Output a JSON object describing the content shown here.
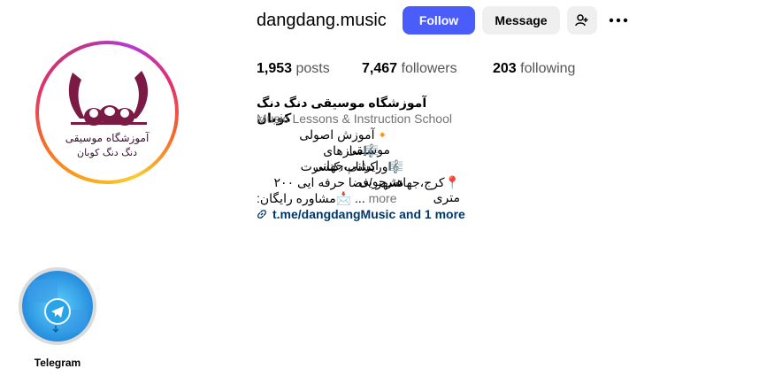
{
  "profile": {
    "username": "dangdang.music",
    "logo_line1": "آموزشگاه موسیقی",
    "logo_line2": "دنگ دنگ کوبان"
  },
  "actions": {
    "follow_label": "Follow",
    "message_label": "Message",
    "suggest_icon": "add-person-icon",
    "more_icon": "more-dots-icon"
  },
  "stats": {
    "posts_count": "1,953",
    "posts_label": "posts",
    "followers_count": "7,467",
    "followers_label": "followers",
    "following_count": "203",
    "following_label": "following"
  },
  "bio": {
    "name": "آموزشگاه موسیقی دنگ دنگ کوبان",
    "category": "Music Lessons & Instruction School",
    "lines": [
      "🔸آموزش اصولی موسیقی",
      "🎼سازهای ایرانی،جهانی",
      "🎼ورکشاپ،کنسرت هنرجویی",
      "📍کرج،جهانشهر /فضا حرفه ایی ۲۰۰ متری",
      "📩مشاوره رایگان:"
    ],
    "ellipsis": "...",
    "more_label": "more",
    "link_text": "t.me/dangdangMusic and 1 more"
  },
  "highlights": [
    {
      "label": "Telegram"
    }
  ],
  "colors": {
    "follow_button": "#4a5df9",
    "secondary_button": "#efefef",
    "link": "#00376b",
    "logo": "#7a1a45"
  }
}
